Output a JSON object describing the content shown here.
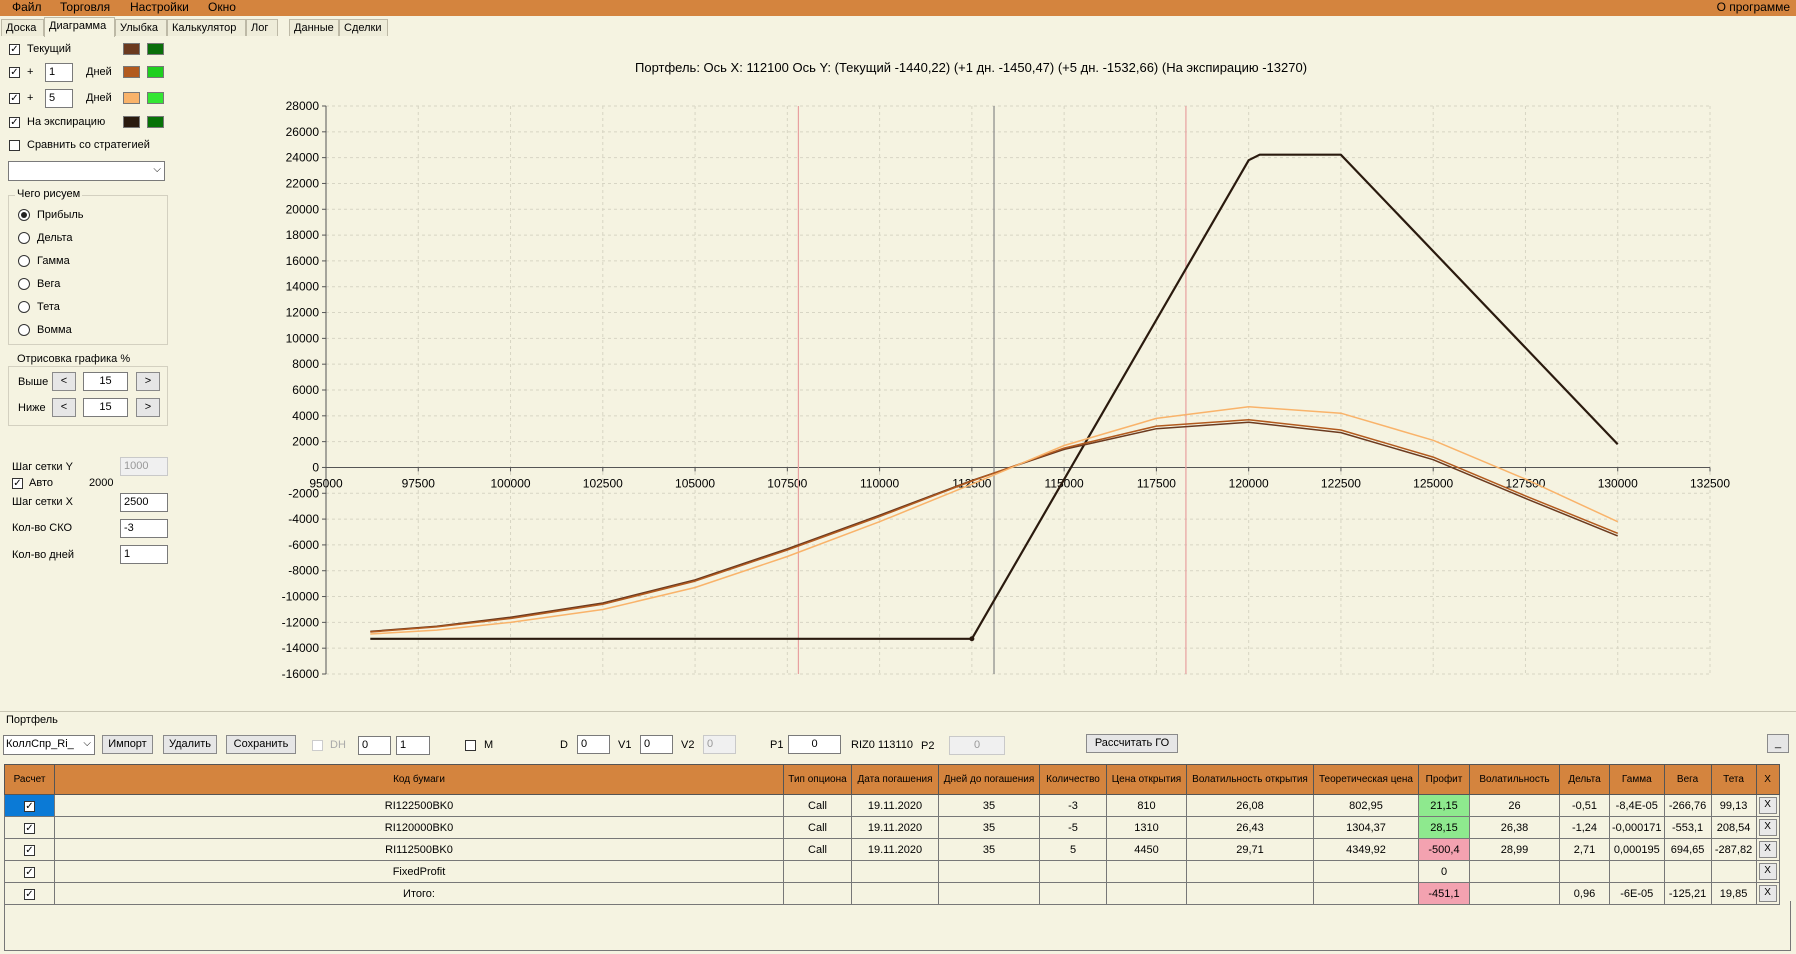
{
  "menu": [
    "Файл",
    "Торговля",
    "Настройки",
    "Окно"
  ],
  "menu_right": "О программе",
  "tabs": [
    "Доска",
    "Диаграмма",
    "Улыбка",
    "Калькулятор",
    "Лог",
    "Данные",
    "Сделки"
  ],
  "active_tab": "Диаграмма",
  "left_panel": {
    "current_label": "Текущий",
    "plus_label": "+",
    "days1": "1",
    "days2": "5",
    "days_label": "Дней",
    "expiry_label": "На экспирацию",
    "compare_label": "Сравнить со стратегией",
    "compare_value": "",
    "what_group": "Чего рисуем",
    "radios": [
      "Прибыль",
      "Дельта",
      "Гамма",
      "Вега",
      "Тета",
      "Вомма"
    ],
    "draw_group": "Отрисовка графика %",
    "above_label": "Выше",
    "below_label": "Ниже",
    "above_value": "15",
    "below_value": "15",
    "prev": "<",
    "next": ">",
    "grid_y_label": "Шаг сетки Y",
    "grid_y_value": "1000",
    "auto_label": "Авто",
    "auto_value": "2000",
    "grid_x_label": "Шаг сетки X",
    "grid_x_value": "2500",
    "sko_label": "Кол-во СКО",
    "sko_value": "-3",
    "days_count_label": "Кол-во дней",
    "days_count_value": "1",
    "colors": {
      "current": [
        "#6b3a1f",
        "#0a6e0a"
      ],
      "d1": [
        "#b25a1e",
        "#1fcf1f"
      ],
      "d5": [
        "#f9b36a",
        "#33e633"
      ],
      "expiry": [
        "#2a1a0e",
        "#077207"
      ]
    }
  },
  "chart_header": "Портфель: Ось X: 112100 Ось Y:  (Текущий -1440,22)  (+1 дн. -1450,47)  (+5 дн. -1532,66)  (На экспирацию -13270)",
  "chart_data": {
    "type": "line",
    "x_ticks": [
      "95000",
      "97500",
      "100000",
      "102500",
      "105000",
      "107500",
      "110000",
      "112500",
      "115000",
      "117500",
      "120000",
      "122500",
      "125000",
      "127500",
      "130000",
      "132500"
    ],
    "y_ticks": [
      "28000",
      "26000",
      "24000",
      "22000",
      "20000",
      "18000",
      "16000",
      "14000",
      "12000",
      "10000",
      "8000",
      "6000",
      "4000",
      "2000",
      "0",
      "-2000",
      "-4000",
      "-6000",
      "-8000",
      "-10000",
      "-12000",
      "-14000",
      "-16000"
    ],
    "xlim": [
      95000,
      132500
    ],
    "ylim": [
      -16000,
      28000
    ],
    "grid": true,
    "vlines": [
      {
        "x": 107800,
        "color": "#e8a0a0"
      },
      {
        "x": 113100,
        "color": "#888888"
      },
      {
        "x": 118300,
        "color": "#e8a0a0"
      }
    ],
    "series": [
      {
        "color": "#2a1a0e",
        "points": [
          [
            96200,
            -13270
          ],
          [
            112500,
            -13270
          ],
          [
            120000,
            23800
          ],
          [
            120300,
            24230
          ],
          [
            122500,
            24230
          ],
          [
            130000,
            1800
          ]
        ]
      },
      {
        "color": "#6b3a1f",
        "points": [
          [
            96200,
            -12700
          ],
          [
            98000,
            -12300
          ],
          [
            100000,
            -11600
          ],
          [
            102500,
            -10500
          ],
          [
            105000,
            -8700
          ],
          [
            107500,
            -6300
          ],
          [
            110000,
            -3700
          ],
          [
            112500,
            -1000
          ],
          [
            115000,
            1400
          ],
          [
            117500,
            3000
          ],
          [
            120000,
            3500
          ],
          [
            122500,
            2700
          ],
          [
            125000,
            600
          ],
          [
            127500,
            -2400
          ],
          [
            130000,
            -5300
          ]
        ]
      },
      {
        "color": "#b25a1e",
        "points": [
          [
            96200,
            -12750
          ],
          [
            98000,
            -12350
          ],
          [
            100000,
            -11700
          ],
          [
            102500,
            -10600
          ],
          [
            105000,
            -8800
          ],
          [
            107500,
            -6400
          ],
          [
            110000,
            -3800
          ],
          [
            112500,
            -1050
          ],
          [
            115000,
            1500
          ],
          [
            117500,
            3200
          ],
          [
            120000,
            3700
          ],
          [
            122500,
            2900
          ],
          [
            125000,
            800
          ],
          [
            127500,
            -2200
          ],
          [
            130000,
            -5100
          ]
        ]
      },
      {
        "color": "#f9b36a",
        "points": [
          [
            96200,
            -12900
          ],
          [
            98000,
            -12600
          ],
          [
            100000,
            -12000
          ],
          [
            102500,
            -11000
          ],
          [
            105000,
            -9300
          ],
          [
            107500,
            -6900
          ],
          [
            110000,
            -4200
          ],
          [
            112500,
            -1300
          ],
          [
            115000,
            1700
          ],
          [
            117500,
            3800
          ],
          [
            120000,
            4700
          ],
          [
            122500,
            4200
          ],
          [
            125000,
            2100
          ],
          [
            127500,
            -900
          ],
          [
            130000,
            -4200
          ]
        ]
      }
    ],
    "markers": [
      {
        "x": 112500,
        "y": -13270
      }
    ]
  },
  "portfolio": {
    "title": "Портфель",
    "combo": "КоллСпр_Ri_",
    "import": "Импорт",
    "delete": "Удалить",
    "save": "Сохранить",
    "dh": "DH",
    "spin1": "0",
    "spin2": "1",
    "m": "M",
    "d_label": "D",
    "d_value": "0",
    "v1_label": "V1",
    "v1_value": "0",
    "v2_label": "V2",
    "v2_value": "0",
    "p1_label": "P1",
    "p1_value": "0",
    "riz": "RIZ0 113110",
    "p2_label": "P2",
    "p2_value": "0",
    "calc_go": "Рассчитать ГО",
    "min_btn": "_"
  },
  "table": {
    "headers": [
      "Расчет",
      "Код бумаги",
      "Тип опциона",
      "Дата погашения",
      "Дней до погашения",
      "Количество",
      "Цена открытия",
      "Волатильность открытия",
      "Теоретическая цена",
      "Профит",
      "Волатильность",
      "Дельта",
      "Гамма",
      "Вега",
      "Тета",
      "X"
    ],
    "rows": [
      [
        "RI122500BK0",
        "Call",
        "19.11.2020",
        "35",
        "-3",
        "810",
        "26,08",
        "802,95",
        "21,15",
        "26",
        "-0,51",
        "-8,4E-05",
        "-266,76",
        "99,13"
      ],
      [
        "RI120000BK0",
        "Call",
        "19.11.2020",
        "35",
        "-5",
        "1310",
        "26,43",
        "1304,37",
        "28,15",
        "26,38",
        "-1,24",
        "-0,000171",
        "-553,1",
        "208,54"
      ],
      [
        "RI112500BK0",
        "Call",
        "19.11.2020",
        "35",
        "5",
        "4450",
        "29,71",
        "4349,92",
        "-500,4",
        "28,99",
        "2,71",
        "0,000195",
        "694,65",
        "-287,82"
      ],
      [
        "FixedProfit",
        "",
        "",
        "",
        "",
        "",
        "",
        "",
        "0",
        "",
        "",
        "",
        "",
        ""
      ],
      [
        "Итого:",
        "",
        "",
        "",
        "",
        "",
        "",
        "",
        "-451,1",
        "",
        "0,96",
        "-6E-05",
        "-125,21",
        "19,85"
      ]
    ],
    "profit_colors": [
      "green",
      "green",
      "red",
      "",
      "red"
    ],
    "x_label": "X"
  }
}
